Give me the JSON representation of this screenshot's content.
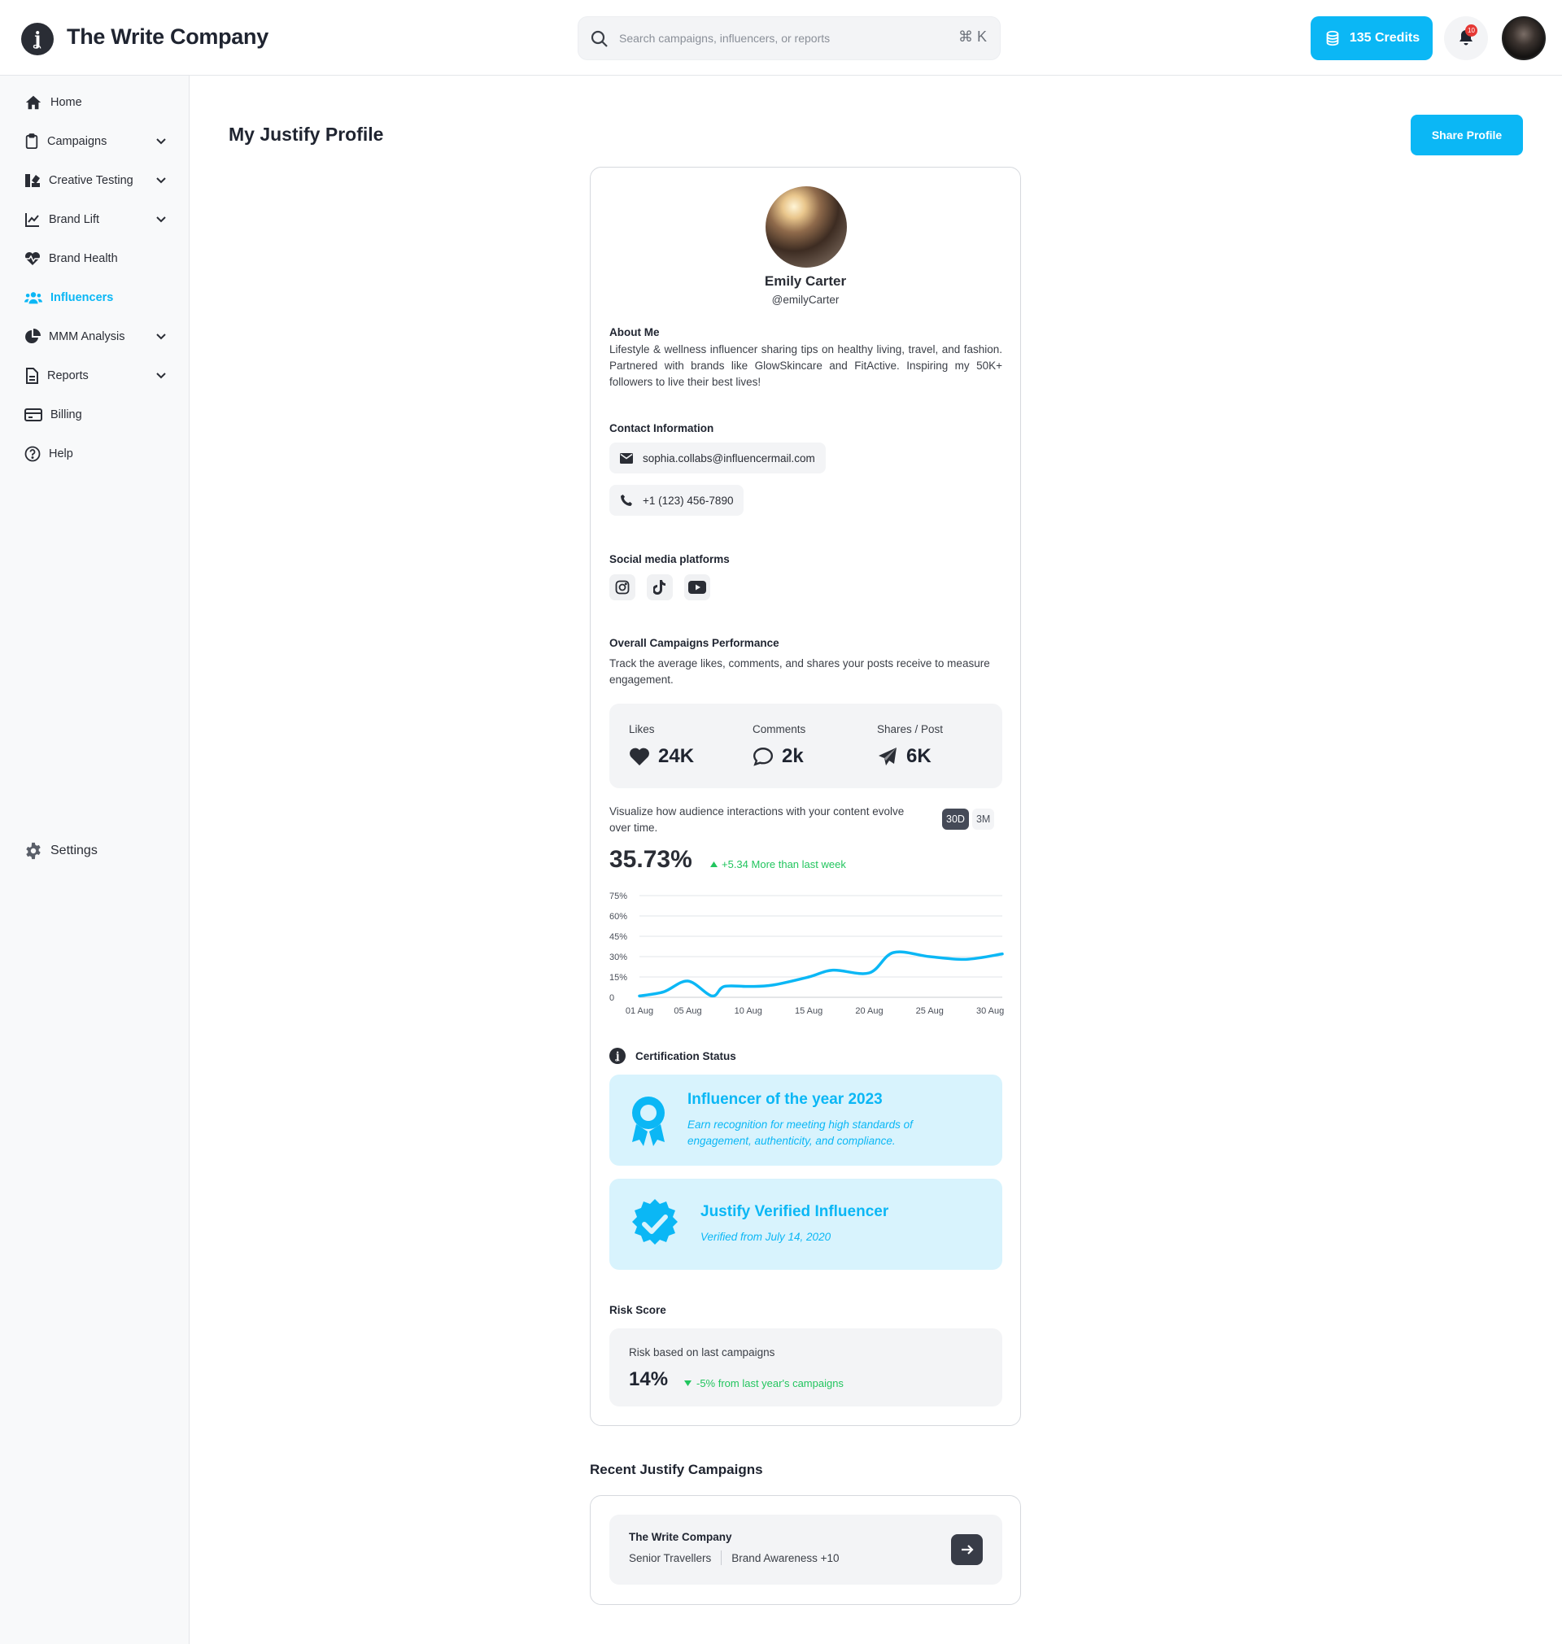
{
  "header": {
    "brand": "The Write Company",
    "search_placeholder": "Search campaigns, influencers, or reports",
    "shortcut": "⌘ K",
    "credits": "135 Credits",
    "notification_count": "10"
  },
  "sidebar": {
    "items": [
      {
        "label": "Home"
      },
      {
        "label": "Campaigns"
      },
      {
        "label": "Creative Testing"
      },
      {
        "label": "Brand Lift"
      },
      {
        "label": "Brand Health"
      },
      {
        "label": "Influencers"
      },
      {
        "label": "MMM Analysis"
      },
      {
        "label": "Reports"
      },
      {
        "label": "Billing"
      },
      {
        "label": "Help"
      }
    ],
    "settings": "Settings"
  },
  "page": {
    "title": "My Justify Profile",
    "share_button": "Share Profile"
  },
  "profile": {
    "name": "Emily Carter",
    "handle": "@emilyCarter",
    "about_label": "About Me",
    "about_text": "Lifestyle & wellness influencer sharing tips on healthy living, travel, and fashion. Partnered with brands like GlowSkincare and FitActive. Inspiring my 50K+ followers to live their best lives!",
    "contact_label": "Contact Information",
    "email": "sophia.collabs@influencermail.com",
    "phone": "+1 (123) 456-7890",
    "social_label": "Social media platforms",
    "social_icons": [
      "instagram-icon",
      "tiktok-icon",
      "youtube-icon"
    ]
  },
  "performance": {
    "label": "Overall Campaigns Performance",
    "description": "Track the average likes, comments, and shares your posts receive to measure engagement.",
    "stats": [
      {
        "label": "Likes",
        "value": "24K"
      },
      {
        "label": "Comments",
        "value": "2k"
      },
      {
        "label": "Shares / Post",
        "value": "6K"
      }
    ],
    "chart_description": "Visualize how audience interactions with your content evolve over time.",
    "range_options": [
      "30D",
      "3M"
    ],
    "selected_range": "30D",
    "headline_value": "35.73%",
    "delta_text": "+5.34 More than last week"
  },
  "chart_data": {
    "type": "line",
    "title": "",
    "xlabel": "",
    "ylabel": "",
    "x": [
      "01 Aug",
      "03 Aug",
      "05 Aug",
      "07 Aug",
      "08 Aug",
      "10 Aug",
      "12 Aug",
      "15 Aug",
      "17 Aug",
      "20 Aug",
      "22 Aug",
      "25 Aug",
      "28 Aug",
      "31 Aug"
    ],
    "values": [
      1,
      4,
      12,
      1,
      8,
      8,
      9,
      15,
      20,
      18,
      33,
      30,
      28,
      32
    ],
    "x_ticks": [
      "01 Aug",
      "05 Aug",
      "10 Aug",
      "15 Aug",
      "20 Aug",
      "25 Aug",
      "30 Aug"
    ],
    "y_ticks": [
      "0",
      "15%",
      "30%",
      "45%",
      "60%",
      "75%"
    ],
    "ylim": [
      0,
      75
    ],
    "grid": true,
    "color": "#0bb7f5"
  },
  "certification": {
    "label": "Certification Status",
    "items": [
      {
        "title": "Influencer of the year 2023",
        "subtitle": "Earn recognition for meeting high standards of engagement, authenticity, and compliance."
      },
      {
        "title": "Justify Verified Influencer",
        "subtitle": "Verified from July 14, 2020"
      }
    ]
  },
  "risk": {
    "label": "Risk Score",
    "caption": "Risk based on last campaigns",
    "value": "14%",
    "delta_text": "-5% from last year's campaigns"
  },
  "recent": {
    "title": "Recent Justify Campaigns",
    "items": [
      {
        "company": "The Write Company",
        "segment": "Senior Travellers",
        "objective": "Brand Awareness +10"
      }
    ]
  },
  "colors": {
    "accent": "#0bb7f5",
    "positive": "#22c55e",
    "dark": "#1f2430"
  }
}
